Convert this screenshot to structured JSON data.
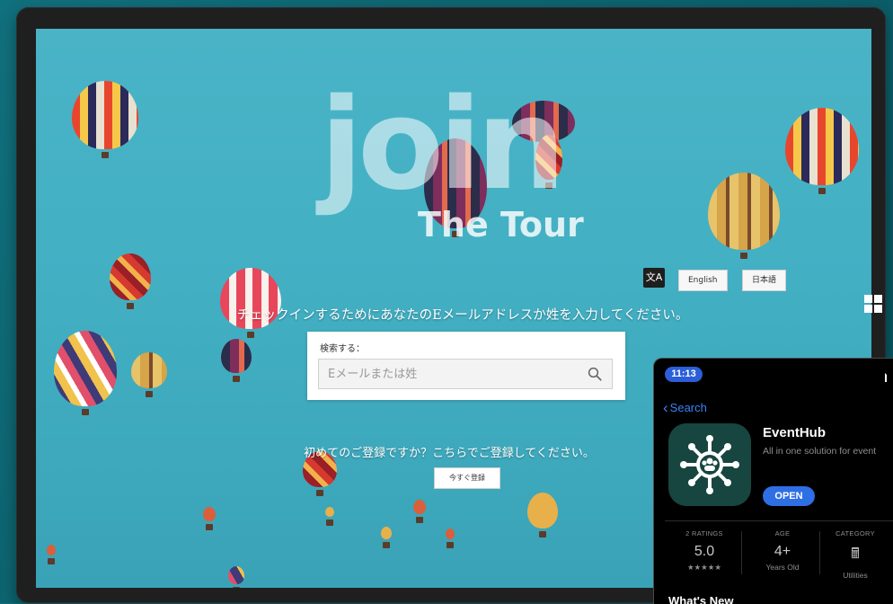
{
  "hero": {
    "join": "JOIN",
    "tour": "The Tour"
  },
  "language": {
    "icon": "translate-icon",
    "english_label": "English",
    "japanese_label": "日本語"
  },
  "instruction": "チェックインするためにあなたのEメールアドレスか姓を入力してください。",
  "search": {
    "label": "検索する：",
    "placeholder": "Eメールまたは姓",
    "value": ""
  },
  "register": {
    "prompt": "初めてのご登録ですか？こちらでご登録してください。",
    "button_label": "今すぐ登録"
  },
  "phone": {
    "time": "11:13",
    "back_label": "Search",
    "app_name": "EventHub",
    "app_subtitle": "All in one solution for event",
    "open_label": "OPEN",
    "stats": [
      {
        "label": "2 RATINGS",
        "value": "5.0",
        "sub": "★★★★★"
      },
      {
        "label": "AGE",
        "value": "4+",
        "sub": "Years Old"
      },
      {
        "label": "CATEGORY",
        "value": "🖩",
        "sub": "Utilities"
      }
    ],
    "cut_heading": "What's New"
  },
  "colors": {
    "sky": "#43b0c4",
    "background": "#0e6673",
    "ios_blue": "#3a82f7",
    "app_icon": "#17453f"
  }
}
